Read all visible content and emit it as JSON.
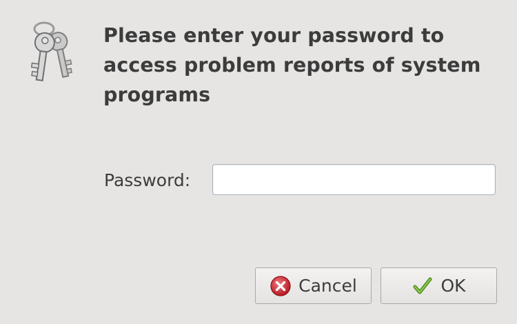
{
  "dialog": {
    "heading": "Please enter your password to access problem reports of system programs",
    "icon": "keys-icon"
  },
  "password": {
    "label": "Password:",
    "value": "",
    "placeholder": ""
  },
  "buttons": {
    "cancel_label": "Cancel",
    "cancel_icon": "cancel-icon",
    "ok_label": "OK",
    "ok_icon": "checkmark-icon"
  },
  "colors": {
    "background": "#e6e5e3",
    "text": "#3c3c3c",
    "cancel_icon": "#c4202a",
    "ok_icon": "#5a9e2a"
  }
}
